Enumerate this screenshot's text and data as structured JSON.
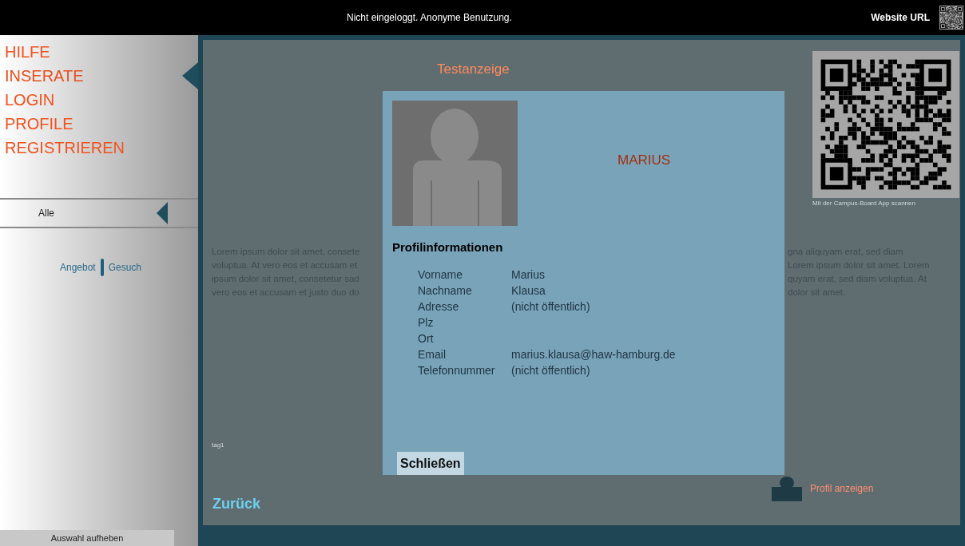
{
  "top_bar": {
    "status": "Nicht eingeloggt. Anonyme Benutzung.",
    "website_link": "Website URL"
  },
  "sidebar": {
    "nav": [
      {
        "label": "HILFE",
        "selected": false
      },
      {
        "label": "INSERATE",
        "selected": true
      },
      {
        "label": "LOGIN",
        "selected": false
      },
      {
        "label": "PROFILE",
        "selected": false
      },
      {
        "label": "REGISTRIEREN",
        "selected": false
      }
    ],
    "filter": "Alle",
    "type_toggle": [
      "Angebot",
      "Gesuch"
    ],
    "clear_selection": "Auswahl aufheben"
  },
  "ad": {
    "title": "Testanzeige",
    "text_left": [
      "Lorem ipsum dolor sit amet, consete",
      "voluptua. At vero eos et accusam et",
      "ipsum dolor sit amet, consetetur sad",
      "vero eos et accusam et justo duo do"
    ],
    "text_right": [
      "gna aliquyam erat, sed diam",
      "Lorem ipsum dolor sit amet. Lorem",
      "quyam erat, sed diam voluptua. At",
      "dolor sit amet."
    ],
    "qr_caption": "Mit der Campus-Board App scannen",
    "tag": "tag1",
    "back": "Zurück",
    "show_profile": "Profil anzeigen"
  },
  "dialog": {
    "name": "MARIUS",
    "heading": "Profilinformationen",
    "fields": [
      {
        "label": "Vorname",
        "value": "Marius"
      },
      {
        "label": "Nachname",
        "value": "Klausa"
      },
      {
        "label": "Adresse",
        "value": "(nicht öffentlich)"
      },
      {
        "label": "Plz"
      },
      {
        "label": "Ort"
      },
      {
        "label": "Email",
        "value": "marius.klausa@haw-hamburg.de"
      },
      {
        "label": "Telefonnummer",
        "value": "(nicht öffentlich)"
      }
    ],
    "close": "Schließen"
  }
}
